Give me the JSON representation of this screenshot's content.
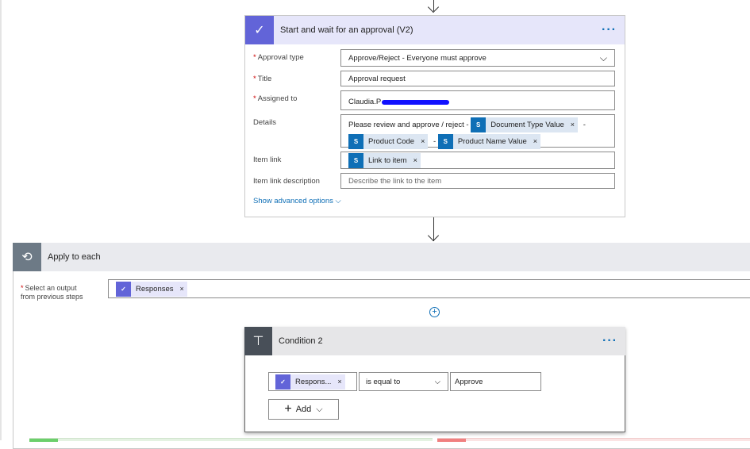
{
  "approval": {
    "title": "Start and wait for an approval (V2)",
    "icon": "approval-icon",
    "fields": {
      "approval_type_label": "Approval type",
      "approval_type_value": "Approve/Reject - Everyone must approve",
      "title_label": "Title",
      "title_value": "Approval request",
      "assigned_label": "Assigned to",
      "assigned_value": "Claudia.P",
      "details_label": "Details",
      "details_text": "Please review and approve / reject -",
      "details_tokens": [
        "Document Type Value",
        "Product Code",
        "Product Name Value"
      ],
      "item_link_label": "Item link",
      "item_link_token": "Link to item",
      "item_link_desc_label": "Item link description",
      "item_link_desc_placeholder": "Describe the link to the item"
    },
    "advanced": "Show advanced options"
  },
  "apply": {
    "title": "Apply to each",
    "select_label_1": "Select an output",
    "select_label_2": "from previous steps",
    "token": "Responses"
  },
  "condition": {
    "title": "Condition 2",
    "token": "Respons...",
    "operator": "is equal to",
    "value": "Approve",
    "add": "Add"
  },
  "colors": {
    "approval": "#6264d8",
    "sharepoint": "#0f6fb6",
    "accent": "#0f6fb6",
    "loop": "#6d7a86",
    "condition": "#484f58"
  }
}
